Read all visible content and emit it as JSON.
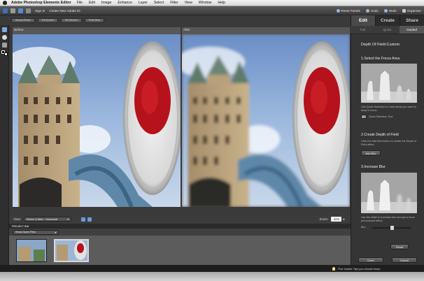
{
  "menubar": {
    "app": "Adobe Photoshop Elements Editor",
    "items": [
      "File",
      "Edit",
      "Image",
      "Enhance",
      "Layer",
      "Select",
      "Filter",
      "View",
      "Window",
      "Help"
    ]
  },
  "toolbar": {
    "sign_in": "Sign In",
    "create_id": "Create New Adobe ID",
    "reset_panels": "Reset Panels",
    "undo": "Undo",
    "redo": "Redo",
    "organizer": "Organizer"
  },
  "view_buttons": [
    "Actual Pixels",
    "Fit Screen",
    "Fill Screen",
    "Print Size"
  ],
  "mode_tabs": [
    "Edit",
    "Create",
    "Share"
  ],
  "sub_tabs": [
    "Full",
    "Quick",
    "Guided"
  ],
  "panes": {
    "before": "Before",
    "after": "After"
  },
  "view_bar": {
    "label": "View:",
    "option": "Before & After - Horizontal",
    "zoom_label": "Zoom:",
    "zoom_value": "32%"
  },
  "bin": {
    "title": "PROJECT BIN",
    "show": "Show Open Files"
  },
  "panel": {
    "title": "Depth Of Field-Custom",
    "step1": "1.Select the Focus Area",
    "step1_text": "Use Quick Selection to mark areas you want to keep in focus.",
    "quick_sel": "Quick Selection Tool",
    "step2": "2.Create Depth of Field",
    "step2_text": "Click the Add Blur button to create the Depth of Field effect",
    "add_blur": "Add Blur",
    "step3": "3.Increase Blur",
    "step3_text": "Use the slider to increase blur and get a more pronounced effect.",
    "blur_label": "Blur",
    "blur_level": 0.5,
    "reset": "Reset",
    "done": "Done",
    "cancel": "Cancel"
  },
  "status": "Five Insider Tips you should know.",
  "colors": {
    "accent": "#4a79c0",
    "panel": "#353535",
    "red_disc": "#b5121b"
  }
}
